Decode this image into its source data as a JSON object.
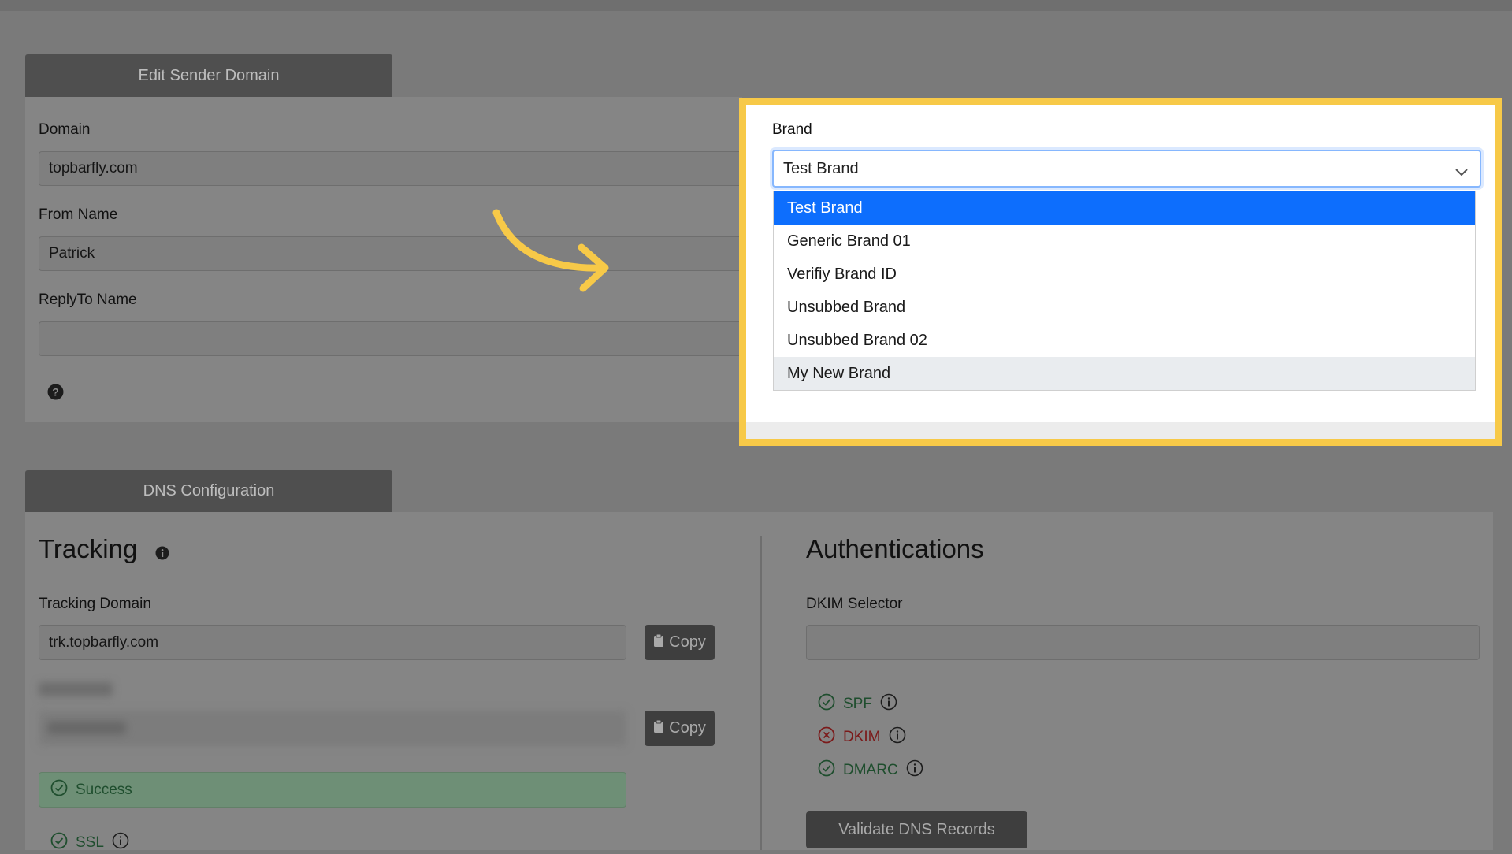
{
  "sender_domain": {
    "tab_label": "Edit Sender Domain",
    "domain_label": "Domain",
    "domain_value": "topbarfly.com",
    "from_name_label": "From Name",
    "from_name_value": "Patrick",
    "replyto_name_label": "ReplyTo Name",
    "replyto_name_value": "",
    "help_icon": "question-circle-icon"
  },
  "brand": {
    "label": "Brand",
    "selected": "Test Brand",
    "options": [
      "Test Brand",
      "Generic Brand 01",
      "Verifiy Brand ID",
      "Unsubbed Brand",
      "Unsubbed Brand 02",
      "My New Brand"
    ],
    "highlight_color": "#f7c948",
    "selected_color": "#0d6efd"
  },
  "dns": {
    "tab_label": "DNS Configuration",
    "tracking": {
      "title": "Tracking",
      "domain_label": "Tracking Domain",
      "domain_value": "trk.topbarfly.com",
      "copy_label": "Copy",
      "copy2_label": "Copy",
      "success_label": "Success",
      "ssl_label": "SSL"
    },
    "auth": {
      "title": "Authentications",
      "dkim_selector_label": "DKIM Selector",
      "dkim_selector_value": "",
      "spf_label": "SPF",
      "dkim_label": "DKIM",
      "dmarc_label": "DMARC",
      "validate_label": "Validate DNS Records"
    }
  }
}
